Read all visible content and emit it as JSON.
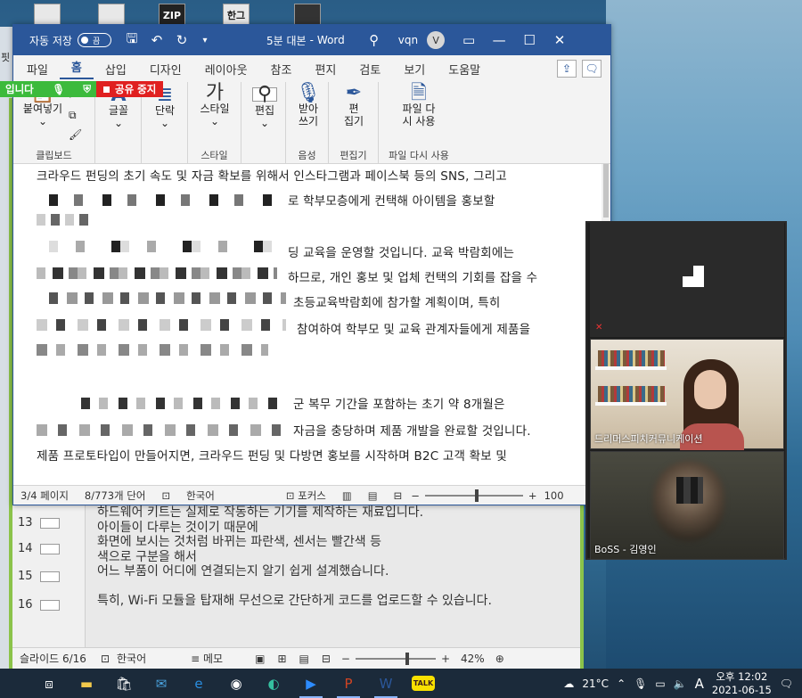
{
  "desktop": {
    "icon_labels": [
      "ZIP",
      "한그"
    ],
    "left_strip_letters": [
      "핏",
      "T",
      "ㄹ"
    ]
  },
  "sharing": {
    "status_text": "입니다",
    "stop_label": "공유 중지"
  },
  "word": {
    "autosave_label": "자동 저장",
    "autosave_state": "끔",
    "doc_title": "5분 대본",
    "app_name": "Word",
    "user_name": "vqn",
    "user_initial": "V",
    "menu": [
      "파일",
      "홈",
      "삽입",
      "디자인",
      "레이아웃",
      "참조",
      "편지",
      "검토",
      "보기",
      "도움말"
    ],
    "active_menu": "홈",
    "ribbon": {
      "paste": "붙여넣기",
      "clipboard_group": "클립보드",
      "font": "글꼴",
      "paragraph": "단락",
      "style_btn": "스타일",
      "style_group": "스타일",
      "edit_btn": "편집",
      "dictate": "받아\n쓰기",
      "voice_group": "음성",
      "editor": "편\n집기",
      "editor_group": "편집기",
      "reuse": "파일 다\n시 사용",
      "reuse_group": "파일 다시 사용"
    },
    "doc_lines": [
      "크라우드 펀딩의 초기 속도 및 자금 확보를 위해서 인스타그램과 페이스북 등의 SNS, 그리고",
      "로 학부모층에게 컨택해 아이템을 홍보할",
      "딩 교육을 운영할 것입니다. 교육 박람회에는",
      "하므로, 개인 홍보 및 업체 컨택의 기회를 잡을 수",
      "초등교육박람회에 참가할 계획이며, 특히",
      "참여하여 학부모 및 교육 관계자들에게 제품을",
      "군 복무 기간을 포함하는 초기 약 8개월은",
      "자금을 충당하며 제품 개발을 완료할 것입니다.",
      "제품 프로토타입이 만들어지면, 크라우드 펀딩 및 다방면 홍보를 시작하며 B2C 고객 확보 및"
    ],
    "status": {
      "page": "3/4 페이지",
      "words": "8/773개 단어",
      "language": "한국어",
      "focus": "포커스",
      "zoom": "100"
    }
  },
  "ppt": {
    "slide_numbers": [
      "13",
      "14",
      "15",
      "16"
    ],
    "notes": [
      "하드웨어 키트는 실제로 작동하는 기기를 제작하는 재료입니다.",
      "아이들이 다루는 것이기 때문에",
      "화면에 보시는 것처럼 바뀌는 파란색, 센서는 빨간색 등",
      "색으로 구분을 해서",
      "어느 부품이 어디에 연결되는지 알기 쉽게 설계했습니다.",
      "",
      "특히, Wi-Fi 모듈을 탑재해 무선으로 간단하게 코드를 업로드할 수 있습니다."
    ],
    "status": {
      "slide": "슬라이드 6/16",
      "language": "한국어",
      "memo": "메모",
      "zoom": "42%"
    }
  },
  "video": {
    "participant1": "드리머스피치커뮤니케이션",
    "participant2": "BoSS - 김영인"
  },
  "taskbar": {
    "weather": "21°C",
    "lang_indicator": "A",
    "time_period": "오후",
    "time": "12:02",
    "date": "2021-06-15",
    "apps": [
      "task-view-icon",
      "file-explorer-icon",
      "store-icon",
      "mail-icon",
      "edge-legacy-icon",
      "chrome-icon",
      "edge-icon",
      "zoom-icon",
      "powerpoint-icon",
      "word-icon",
      "kakaotalk-icon"
    ],
    "kakao_label": "TALK"
  }
}
